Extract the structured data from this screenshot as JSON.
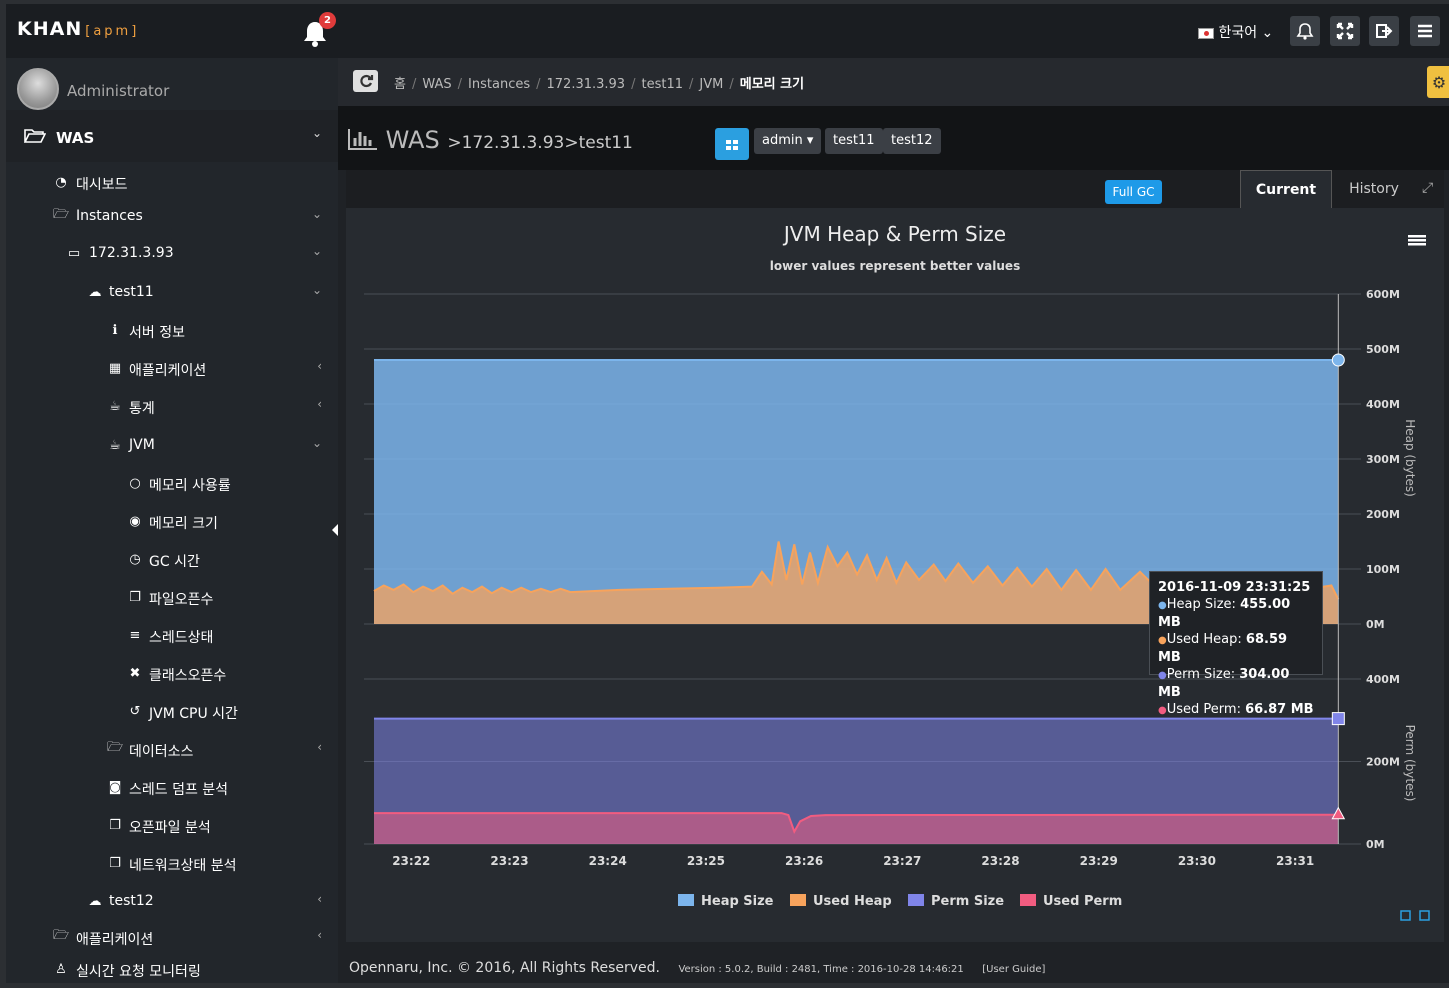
{
  "app": {
    "logo": "KHAN",
    "logo_sub": "apm",
    "notification_count": "2",
    "language": "한국어"
  },
  "user": {
    "name": "Administrator"
  },
  "sidebar": {
    "root": "WAS",
    "items": [
      {
        "label": "대시보드",
        "icon": "dashboard-icon"
      },
      {
        "label": "Instances",
        "icon": "folder-open-icon"
      },
      {
        "label": "172.31.3.93",
        "icon": "monitor-icon"
      },
      {
        "label": "test11",
        "icon": "cloud-icon"
      },
      {
        "label": "서버 정보",
        "icon": "info-icon"
      },
      {
        "label": "애플리케이션",
        "icon": "grid-icon"
      },
      {
        "label": "통계",
        "icon": "coffee-icon"
      },
      {
        "label": "JVM",
        "icon": "coffee-icon"
      },
      {
        "label": "메모리 사용률",
        "icon": "circle-icon"
      },
      {
        "label": "메모리 크기",
        "icon": "dot-circle-icon"
      },
      {
        "label": "GC 시간",
        "icon": "clock-icon"
      },
      {
        "label": "파일오픈수",
        "icon": "files-icon"
      },
      {
        "label": "스레드상태",
        "icon": "list-icon"
      },
      {
        "label": "클래스오픈수",
        "icon": "bug-icon"
      },
      {
        "label": "JVM CPU 시간",
        "icon": "history-icon"
      },
      {
        "label": "데이터소스",
        "icon": "folder-open-icon"
      },
      {
        "label": "스레드 덤프 분석",
        "icon": "camera-icon"
      },
      {
        "label": "오픈파일 분석",
        "icon": "files-icon"
      },
      {
        "label": "네트워크상태 분석",
        "icon": "files-icon"
      },
      {
        "label": "test12",
        "icon": "cloud-icon"
      },
      {
        "label": "애플리케이션",
        "icon": "folder-open-icon"
      },
      {
        "label": "실시간 요청 모니터링",
        "icon": "person-icon"
      }
    ]
  },
  "breadcrumb": [
    "홈",
    "WAS",
    "Instances",
    "172.31.3.93",
    "test11",
    "JVM",
    "메모리 크기"
  ],
  "header": {
    "title": "WAS",
    "path": ">172.31.3.93>test11",
    "user_dropdown": "admin",
    "tags": [
      "test11",
      "test12"
    ]
  },
  "panel": {
    "full_gc_label": "Full GC",
    "tabs": [
      "Current",
      "History"
    ]
  },
  "tooltip": {
    "time": "2016-11-09 23:31:25",
    "rows": [
      {
        "name": "Heap Size",
        "value": "455.00 MB",
        "color": "#7cb5ec"
      },
      {
        "name": "Used Heap",
        "value": "68.59 MB",
        "color": "#f7a35c"
      },
      {
        "name": "Perm Size",
        "value": "304.00 MB",
        "color": "#8085e9"
      },
      {
        "name": "Used Perm",
        "value": "66.87 MB",
        "color": "#f15c80"
      }
    ]
  },
  "footer": {
    "copyright": "Opennaru, Inc. © 2016, All Rights Reserved.",
    "version": "Version : 5.0.2, Build : 2481, Time : 2016-10-28 14:46:21",
    "guide": "[User Guide]"
  },
  "chart_data": {
    "type": "area",
    "title": "JVM Heap & Perm Size",
    "subtitle": "lower values represent better values",
    "x_ticks": [
      "23:22",
      "23:23",
      "23:24",
      "23:25",
      "23:26",
      "23:27",
      "23:28",
      "23:29",
      "23:30",
      "23:31"
    ],
    "x_range": [
      "23:21:36",
      "23:31:25"
    ],
    "heap_axis": {
      "label": "Heap (bytes)",
      "ticks": [
        "0M",
        "100M",
        "200M",
        "300M",
        "400M",
        "500M",
        "600M"
      ],
      "range": [
        0,
        600
      ]
    },
    "perm_axis": {
      "label": "Perm (bytes)",
      "ticks": [
        "0M",
        "200M",
        "400M"
      ],
      "range": [
        0,
        400
      ]
    },
    "legend": [
      "Heap Size",
      "Used Heap",
      "Perm Size",
      "Used Perm"
    ],
    "colors": {
      "heap_size": "#7cb5ec",
      "used_heap": "#f7a35c",
      "perm_size": "#8085e9",
      "used_perm": "#f15c80"
    },
    "series": [
      {
        "name": "Heap Size",
        "panel": "heap",
        "values": [
          {
            "t": 0,
            "v": 480
          },
          {
            "t": 9.82,
            "v": 480
          }
        ]
      },
      {
        "name": "Used Heap",
        "panel": "heap",
        "values": [
          {
            "t": 0.0,
            "v": 60
          },
          {
            "t": 0.1,
            "v": 70
          },
          {
            "t": 0.2,
            "v": 62
          },
          {
            "t": 0.3,
            "v": 72
          },
          {
            "t": 0.4,
            "v": 58
          },
          {
            "t": 0.5,
            "v": 68
          },
          {
            "t": 0.6,
            "v": 60
          },
          {
            "t": 0.7,
            "v": 70
          },
          {
            "t": 0.8,
            "v": 55
          },
          {
            "t": 0.9,
            "v": 66
          },
          {
            "t": 1.0,
            "v": 58
          },
          {
            "t": 1.1,
            "v": 68
          },
          {
            "t": 1.2,
            "v": 56
          },
          {
            "t": 1.3,
            "v": 66
          },
          {
            "t": 1.4,
            "v": 58
          },
          {
            "t": 1.5,
            "v": 66
          },
          {
            "t": 1.6,
            "v": 58
          },
          {
            "t": 1.7,
            "v": 64
          },
          {
            "t": 1.8,
            "v": 58
          },
          {
            "t": 1.9,
            "v": 64
          },
          {
            "t": 2.0,
            "v": 58
          },
          {
            "t": 2.5,
            "v": 62
          },
          {
            "t": 3.0,
            "v": 64
          },
          {
            "t": 3.5,
            "v": 66
          },
          {
            "t": 3.85,
            "v": 68
          },
          {
            "t": 3.95,
            "v": 95
          },
          {
            "t": 4.05,
            "v": 72
          },
          {
            "t": 4.12,
            "v": 150
          },
          {
            "t": 4.2,
            "v": 80
          },
          {
            "t": 4.28,
            "v": 145
          },
          {
            "t": 4.36,
            "v": 72
          },
          {
            "t": 4.44,
            "v": 130
          },
          {
            "t": 4.52,
            "v": 75
          },
          {
            "t": 4.62,
            "v": 140
          },
          {
            "t": 4.72,
            "v": 105
          },
          {
            "t": 4.82,
            "v": 130
          },
          {
            "t": 4.92,
            "v": 90
          },
          {
            "t": 5.02,
            "v": 125
          },
          {
            "t": 5.12,
            "v": 80
          },
          {
            "t": 5.22,
            "v": 120
          },
          {
            "t": 5.32,
            "v": 75
          },
          {
            "t": 5.42,
            "v": 112
          },
          {
            "t": 5.55,
            "v": 80
          },
          {
            "t": 5.7,
            "v": 108
          },
          {
            "t": 5.82,
            "v": 78
          },
          {
            "t": 5.95,
            "v": 110
          },
          {
            "t": 6.1,
            "v": 75
          },
          {
            "t": 6.25,
            "v": 105
          },
          {
            "t": 6.4,
            "v": 70
          },
          {
            "t": 6.55,
            "v": 102
          },
          {
            "t": 6.7,
            "v": 68
          },
          {
            "t": 6.85,
            "v": 100
          },
          {
            "t": 7.0,
            "v": 62
          },
          {
            "t": 7.15,
            "v": 98
          },
          {
            "t": 7.3,
            "v": 62
          },
          {
            "t": 7.45,
            "v": 100
          },
          {
            "t": 7.6,
            "v": 62
          },
          {
            "t": 7.8,
            "v": 95
          },
          {
            "t": 8.0,
            "v": 60
          },
          {
            "t": 8.2,
            "v": 92
          },
          {
            "t": 8.4,
            "v": 62
          },
          {
            "t": 8.6,
            "v": 90
          },
          {
            "t": 8.8,
            "v": 62
          },
          {
            "t": 9.0,
            "v": 88
          },
          {
            "t": 9.2,
            "v": 62
          },
          {
            "t": 9.4,
            "v": 85
          },
          {
            "t": 9.6,
            "v": 66
          },
          {
            "t": 9.75,
            "v": 70
          },
          {
            "t": 9.82,
            "v": 45
          }
        ]
      },
      {
        "name": "Perm Size",
        "panel": "perm",
        "values": [
          {
            "t": 0,
            "v": 304
          },
          {
            "t": 9.82,
            "v": 304
          }
        ]
      },
      {
        "name": "Used Perm",
        "panel": "perm",
        "values": [
          {
            "t": 0,
            "v": 75
          },
          {
            "t": 4.15,
            "v": 75
          },
          {
            "t": 4.22,
            "v": 70
          },
          {
            "t": 4.28,
            "v": 30
          },
          {
            "t": 4.34,
            "v": 55
          },
          {
            "t": 4.45,
            "v": 68
          },
          {
            "t": 4.6,
            "v": 70
          },
          {
            "t": 9.82,
            "v": 71
          }
        ]
      }
    ]
  }
}
